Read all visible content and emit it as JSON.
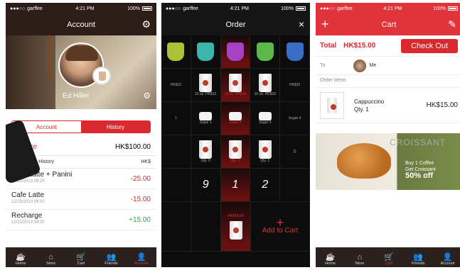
{
  "status": {
    "carrier": "garffee",
    "time": "4:21 PM",
    "battery": "100%"
  },
  "account": {
    "title": "Account",
    "user_name": "Ed Hiller",
    "seg": {
      "account": "Account",
      "history": "History"
    },
    "balance_label": "Balance",
    "balance_value": "HK$100.00",
    "tx_head_label": "Transaction History",
    "tx_head_unit": "HK$",
    "transactions": [
      {
        "name": "Cafe Latte + Panini",
        "date": "12/12/2013 09:20",
        "amount": "-25.00"
      },
      {
        "name": "Cafe Latte",
        "date": "12/15/2013 09:20",
        "amount": "-15.00"
      },
      {
        "name": "Recharge",
        "date": "12/12/2013 09:30",
        "amount": "+15.00"
      }
    ]
  },
  "order": {
    "title": "Order",
    "close_icon": "×",
    "size_labels": [
      "HK$10",
      "10 oz. HK$12",
      "14 oz. HK$16",
      "16 oz. HK$18",
      "HK$20"
    ],
    "sugar_labels": [
      "1",
      "Sugar 1",
      "Sugar 2",
      "Sugar 3",
      "Sugar 4"
    ],
    "qty_labels": [
      "",
      "Qty. 0",
      "Qty. 1",
      "Qty. 2",
      "Q"
    ],
    "qty_numbers": [
      "",
      "9",
      "1",
      "2",
      ""
    ],
    "bottom_price": "HK$15.00",
    "add_to_cart": "Add to Cart",
    "add_plus": "+"
  },
  "cart": {
    "title": "Cart",
    "total_label": "Total",
    "total_value": "HK$15.00",
    "checkout": "Check Out",
    "to_label": "To",
    "to_name": "Me",
    "order_items": "Order items",
    "item_name": "Cappuccino",
    "item_qty": "Qty. 1",
    "item_price": "HK$15.00",
    "promo_brand": "CROISSANT",
    "promo_line1": "Buy 1 Coffee",
    "promo_line2": "Get Croissant",
    "promo_line3": "50% off"
  },
  "tabs": [
    "Home",
    "Store",
    "Cart",
    "Friends",
    "Account"
  ],
  "capsule_colors": [
    "#a9c23a",
    "#3bb5a8",
    "#a542c4",
    "#5ab94a",
    "#3a6ec4"
  ]
}
